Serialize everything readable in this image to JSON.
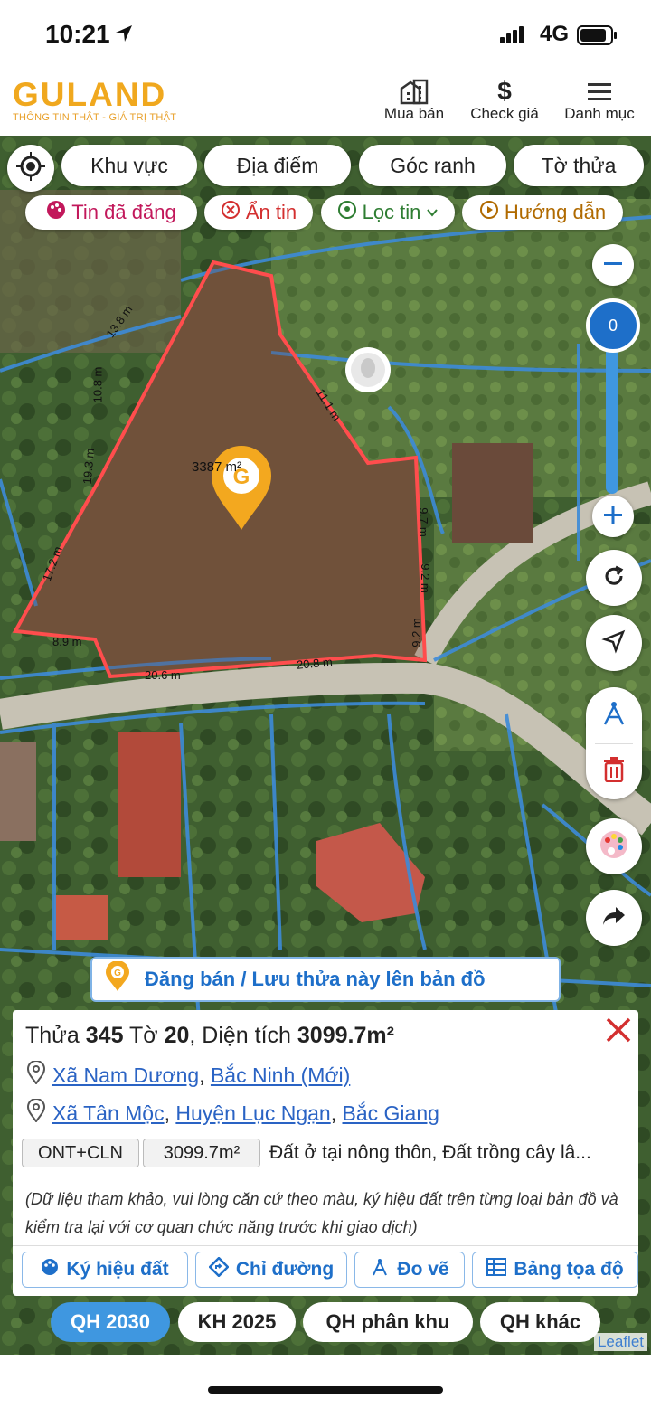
{
  "status": {
    "time": "10:21",
    "network": "4G"
  },
  "header": {
    "brand": "GULAND",
    "tagline": "THÔNG TIN THẬT - GIÁ TRỊ THẬT",
    "nav": [
      {
        "label": "Mua bán",
        "icon": "building-icon"
      },
      {
        "label": "Check giá",
        "icon": "dollar-icon"
      },
      {
        "label": "Danh mục",
        "icon": "menu-icon"
      }
    ]
  },
  "filters": {
    "row1": [
      "Khu vực",
      "Địa điểm",
      "Góc ranh",
      "Tờ thửa"
    ],
    "row2": [
      {
        "label": "Tin đã đăng",
        "icon": "palette-icon",
        "color": "#c2185b"
      },
      {
        "label": "Ẩn tin",
        "icon": "close-circle-icon",
        "color": "#d32f2f"
      },
      {
        "label": "Lọc tin",
        "icon": "location-pin-icon",
        "color": "#2e7d32"
      },
      {
        "label": "Hướng dẫn",
        "icon": "play-circle-icon",
        "color": "#b06a00"
      }
    ]
  },
  "map": {
    "area_marker": "3387 m²",
    "edge_labels": [
      "13.8 m",
      "10.8 m",
      "19.3 m",
      "17.2 m",
      "8.9 m",
      "20.6 m",
      "20.8 m",
      "9.2 m",
      "9.2 m",
      "9.7 m",
      "11.1 m"
    ],
    "zoom_value": "0",
    "post_bar": "Đăng bán / Lưu thửa này lên bản đồ",
    "parcel_color": "#ff4d4d",
    "boundary_color": "#3d8bd8"
  },
  "panel": {
    "title_prefix": "Thửa ",
    "parcel_no": "345",
    "title_mid": " Tờ ",
    "sheet_no": "20",
    "title_mid2": ", Diện tích ",
    "area": "3099.7m²",
    "address1": {
      "commune": "Xã Nam Dương",
      "province": "Bắc Ninh (Mới)"
    },
    "address2": {
      "commune": "Xã Tân Mộc",
      "district": "Huyện Lục Ngạn",
      "province": "Bắc Giang"
    },
    "land_code": "ONT+CLN",
    "land_area": "3099.7m²",
    "land_desc": "Đất ở tại nông thôn, Đất trồng cây lâ...",
    "note": "(Dữ liệu tham khảo, vui lòng căn cứ theo màu, ký hiệu đất trên từng loại bản đồ và kiểm tra lại với cơ quan chức năng trước khi giao dịch)",
    "actions": [
      {
        "label": "Ký hiệu đất",
        "icon": "palette-icon"
      },
      {
        "label": "Chỉ đường",
        "icon": "directions-icon"
      },
      {
        "label": "Đo vẽ",
        "icon": "compass-icon"
      },
      {
        "label": "Bảng tọa độ",
        "icon": "table-icon"
      }
    ]
  },
  "tabs": [
    "QH 2030",
    "KH 2025",
    "QH phân khu",
    "QH khác"
  ],
  "attribution": "Leaflet"
}
